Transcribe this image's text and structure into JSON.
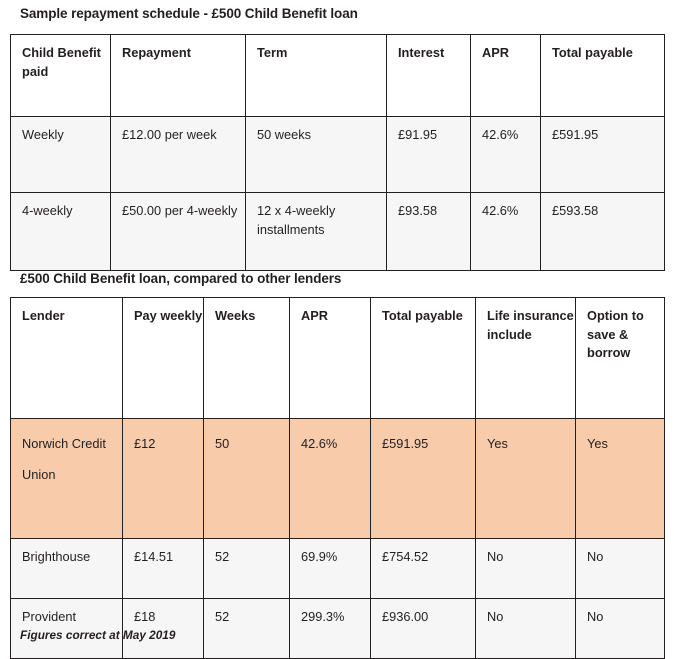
{
  "page": {
    "background_color": "#ffffff",
    "text_color": "#231f20",
    "border_color": "#231f20",
    "highlight_color": "#f8cbab",
    "row_color": "#f6f6f6"
  },
  "schedule": {
    "title": "Sample repayment schedule - £500 Child Benefit loan",
    "columns": [
      "Child Benefit paid",
      "Repayment",
      "Term",
      "Interest",
      "APR",
      "Total payable"
    ],
    "rows": [
      {
        "child_benefit_paid": "Weekly",
        "repayment": "£12.00 per week",
        "term": "50 weeks",
        "interest": "£91.95",
        "apr": "42.6%",
        "total_payable": "£591.95"
      },
      {
        "child_benefit_paid": "4-weekly",
        "repayment": "£50.00 per 4-weekly",
        "term": "12 x 4-weekly installments",
        "interest": "£93.58",
        "apr": "42.6%",
        "total_payable": "£593.58"
      }
    ]
  },
  "comparison": {
    "title": "£500 Child Benefit loan, compared to other lenders",
    "columns": [
      "Lender",
      "Pay weekly",
      "Weeks",
      "APR",
      "Total payable",
      "Life insurance include",
      "Option to save & borrow"
    ],
    "rows": [
      {
        "lender": "Norwich Credit Union",
        "pay_weekly": "£12",
        "weeks": "50",
        "apr": "42.6%",
        "total_payable": "£591.95",
        "life_insurance_include": "Yes",
        "option_to_save_and_borrow": "Yes",
        "highlighted": true
      },
      {
        "lender": "Brighthouse",
        "pay_weekly": "£14.51",
        "weeks": "52",
        "apr": "69.9%",
        "total_payable": "£754.52",
        "life_insurance_include": "No",
        "option_to_save_and_borrow": "No",
        "highlighted": false
      },
      {
        "lender": "Provident",
        "pay_weekly": "£18",
        "weeks": "52",
        "apr": "299.3%",
        "total_payable": "£936.00",
        "life_insurance_include": "No",
        "option_to_save_and_borrow": "No",
        "highlighted": false
      }
    ]
  },
  "footnote": "Figures correct at May 2019"
}
